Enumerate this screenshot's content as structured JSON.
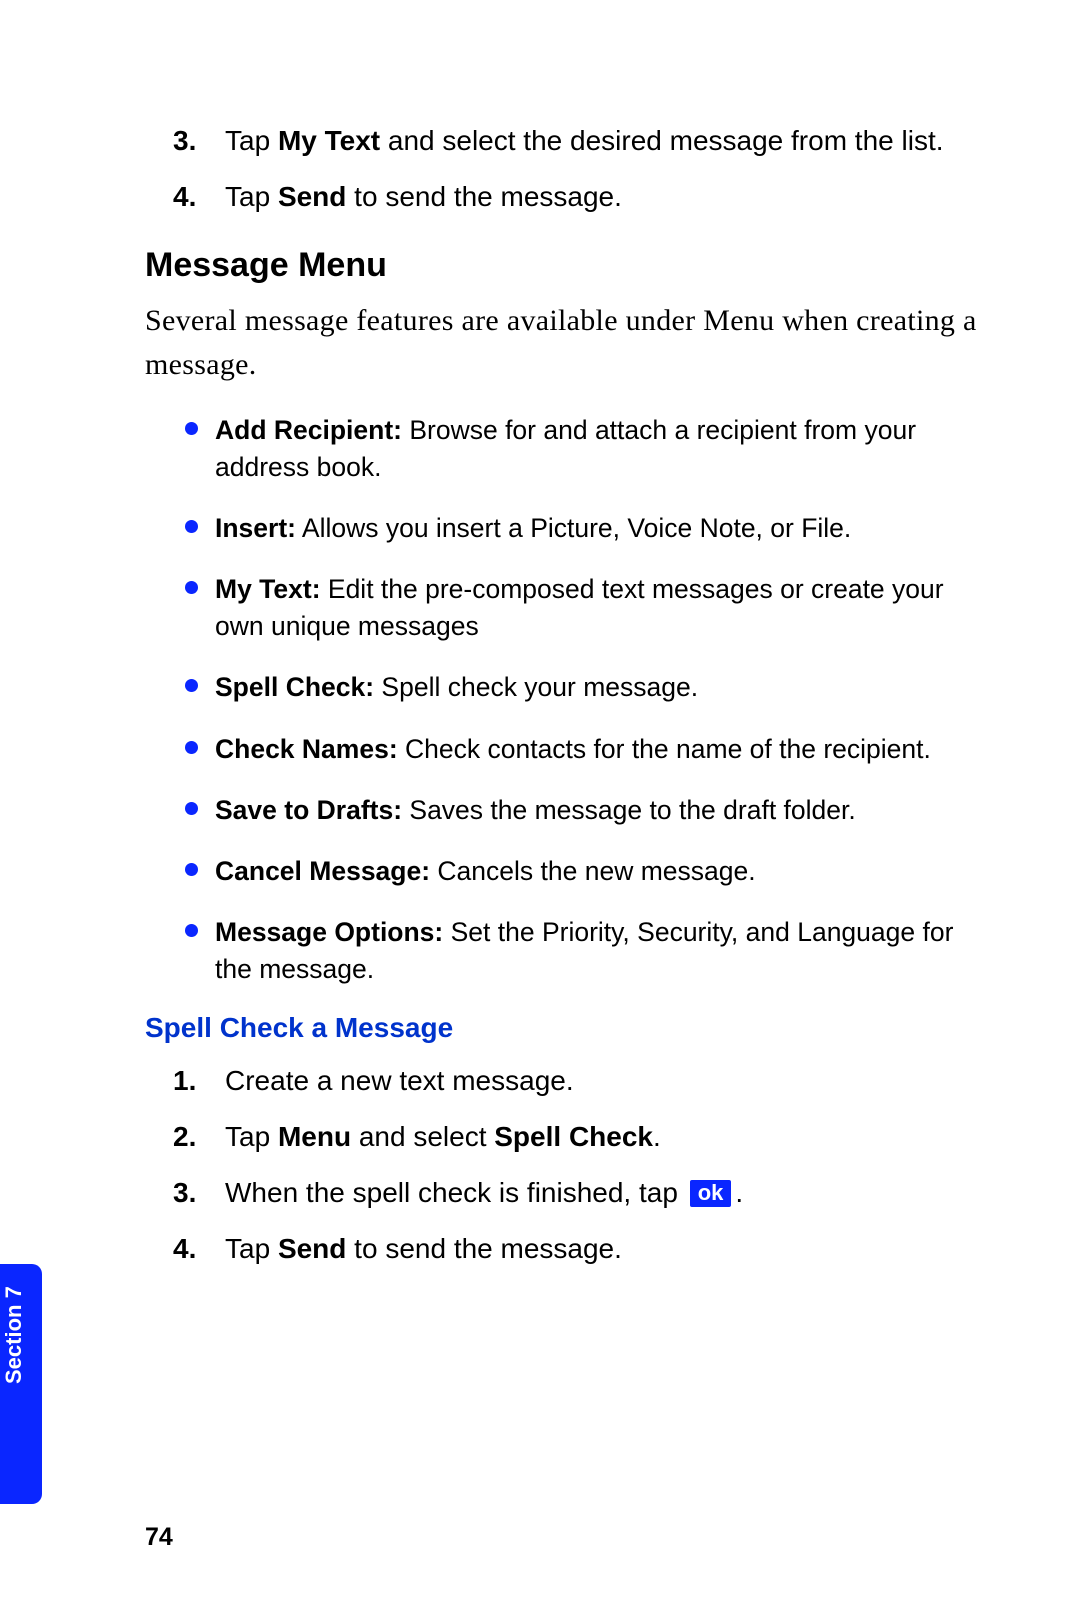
{
  "top_list": [
    {
      "n": "3.",
      "pre": "Tap ",
      "bold": "My Text",
      "post": " and select the desired message from the list."
    },
    {
      "n": "4.",
      "pre": "Tap ",
      "bold": "Send",
      "post": " to send the message."
    }
  ],
  "h2": "Message Menu",
  "intro": "Several message features are available under Menu when creating a message.",
  "bullets": [
    {
      "title": "Add Recipient:",
      "body": " Browse for and attach a recipient from your address book."
    },
    {
      "title": "Insert:",
      "body": " Allows you insert a Picture, Voice Note, or File."
    },
    {
      "title": "My Text:",
      "body": " Edit the pre-composed text messages or create your own unique messages"
    },
    {
      "title": "Spell Check:",
      "body": " Spell check your message."
    },
    {
      "title": "Check Names:",
      "body": " Check contacts for the name of the recipient."
    },
    {
      "title": "Save to Drafts:",
      "body": " Saves the message to the draft folder."
    },
    {
      "title": "Cancel Message:",
      "body": " Cancels the new message."
    },
    {
      "title": "Message Options:",
      "body": " Set the Priority, Security, and Language for the message."
    }
  ],
  "h3": "Spell Check a Message",
  "spell_list": {
    "1": {
      "n": "1.",
      "text": "Create a new text message."
    },
    "2": {
      "n": "2.",
      "pre": "Tap ",
      "b1": "Menu",
      "mid": " and select ",
      "b2": "Spell Check",
      "post": "."
    },
    "3": {
      "n": "3.",
      "pre": "When the spell check is finished, tap ",
      "ok": "ok",
      "post": "."
    },
    "4": {
      "n": "4.",
      "pre": "Tap ",
      "bold": "Send",
      "post": " to send the message."
    }
  },
  "section_tab": "Section 7",
  "page_number": "74"
}
